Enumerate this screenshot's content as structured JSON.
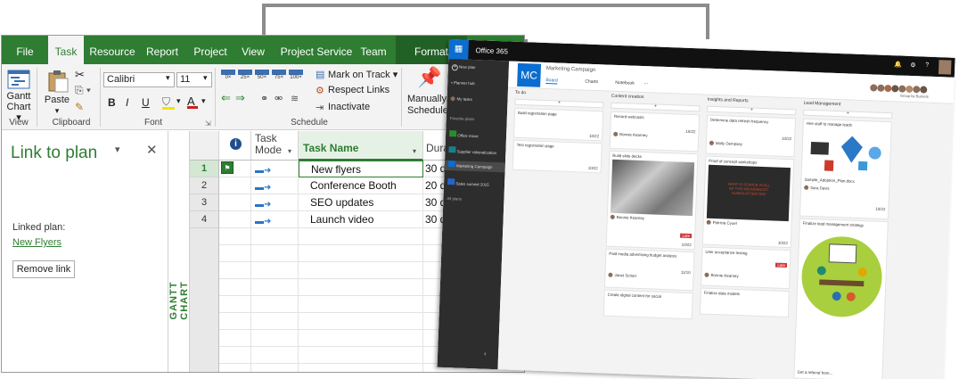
{
  "project": {
    "tabs": [
      {
        "label": "File"
      },
      {
        "label": "Task"
      },
      {
        "label": "Resource"
      },
      {
        "label": "Report"
      },
      {
        "label": "Project"
      },
      {
        "label": "View"
      },
      {
        "label": "Project Service"
      },
      {
        "label": "Team"
      },
      {
        "label": "Format"
      }
    ],
    "ribbon": {
      "gantt_chart": "Gantt\nChart ▾",
      "view_group": "View",
      "paste": "Paste",
      "clipboard_group": "Clipboard",
      "font_name": "Calibri",
      "font_size": "11",
      "bold": "B",
      "italic": "I",
      "underline": "U",
      "font_group": "Font",
      "zoom_labels": [
        "0×",
        "25×",
        "50×",
        "75×",
        "100×"
      ],
      "mark_on_track": "Mark on Track ▾",
      "respect_links": "Respect Links",
      "inactivate": "Inactivate",
      "schedule_group": "Schedule",
      "manually": "Manually",
      "schedule": "Schedule"
    },
    "pane": {
      "title": "Link to plan",
      "linked_plan_label": "Linked plan:",
      "linked_plan_link": "New Flyers",
      "remove_link": "Remove link"
    },
    "side_label": "GANTT CHART",
    "grid": {
      "headers": {
        "task_mode": "Task\nMode",
        "task_name": "Task Name",
        "duration": "Dura"
      },
      "rows": [
        {
          "num": "1",
          "name": "New flyers",
          "duration": "30 d"
        },
        {
          "num": "2",
          "name": "Conference Booth",
          "duration": "20 d"
        },
        {
          "num": "3",
          "name": "SEO updates",
          "duration": "30 d"
        },
        {
          "num": "4",
          "name": "Launch video",
          "duration": "30 d"
        }
      ]
    }
  },
  "o365": {
    "app_title": "Office 365",
    "side": {
      "new_plan": "New plan",
      "planner_hub": "Planner hub",
      "my_tasks": "My tasks",
      "favorite_plans": "Favorite plans",
      "items": [
        "Office move",
        "Supplier rationalization",
        "Marketing Campaign",
        "Sales summit 2015"
      ],
      "all_plans": "All plans"
    },
    "plan": {
      "initials": "MC",
      "name": "Marketing Campaign",
      "board": "Board",
      "charts": "Charts",
      "notebook": "Notebook",
      "more": "...",
      "group_by": "Group by Buckets"
    },
    "buckets": [
      {
        "name": "To do",
        "cards": [
          {
            "title": "Build registration page",
            "date": "10/22"
          },
          {
            "title": "Test registration page",
            "date": "10/22"
          }
        ]
      },
      {
        "name": "Content creation",
        "cards": [
          {
            "title": "Record webcasts",
            "person": "Bonnie Kearney",
            "date": "10/22"
          },
          {
            "title": "Build slide decks",
            "person": "Bonnie Kearney",
            "date": "10/22",
            "badge": "Late"
          },
          {
            "title": "Paid media advertising budget analysis",
            "person": "Janet Schorr",
            "date": "11/10"
          },
          {
            "title": "Create digital content for social"
          }
        ]
      },
      {
        "name": "Insights and Reports",
        "cards": [
          {
            "title": "Determine data refresh frequency",
            "person": "Molly Dempsey",
            "date": "10/22"
          },
          {
            "title": "Proof of concept workshops",
            "slide_text": "WHAT IS SCARCE IN ALL OF THIS ABUNDANCE? HUMAN ATTENTION",
            "person": "Patricia Cyuel",
            "date": "10/22"
          },
          {
            "title": "User acceptance testing",
            "person": "Bonnie Kearney",
            "badge": "Late"
          },
          {
            "title": "Finalize data models"
          }
        ]
      },
      {
        "name": "Lead Management",
        "cards": [
          {
            "title": "Hire staff to manage leads",
            "attachment": "Sample_Adoption_Plan.docx",
            "person": "Sara Davis",
            "date": "10/22"
          },
          {
            "title": "Finalize lead management strategy",
            "footer": "Get a referral from..."
          }
        ]
      }
    ],
    "add": "+"
  }
}
